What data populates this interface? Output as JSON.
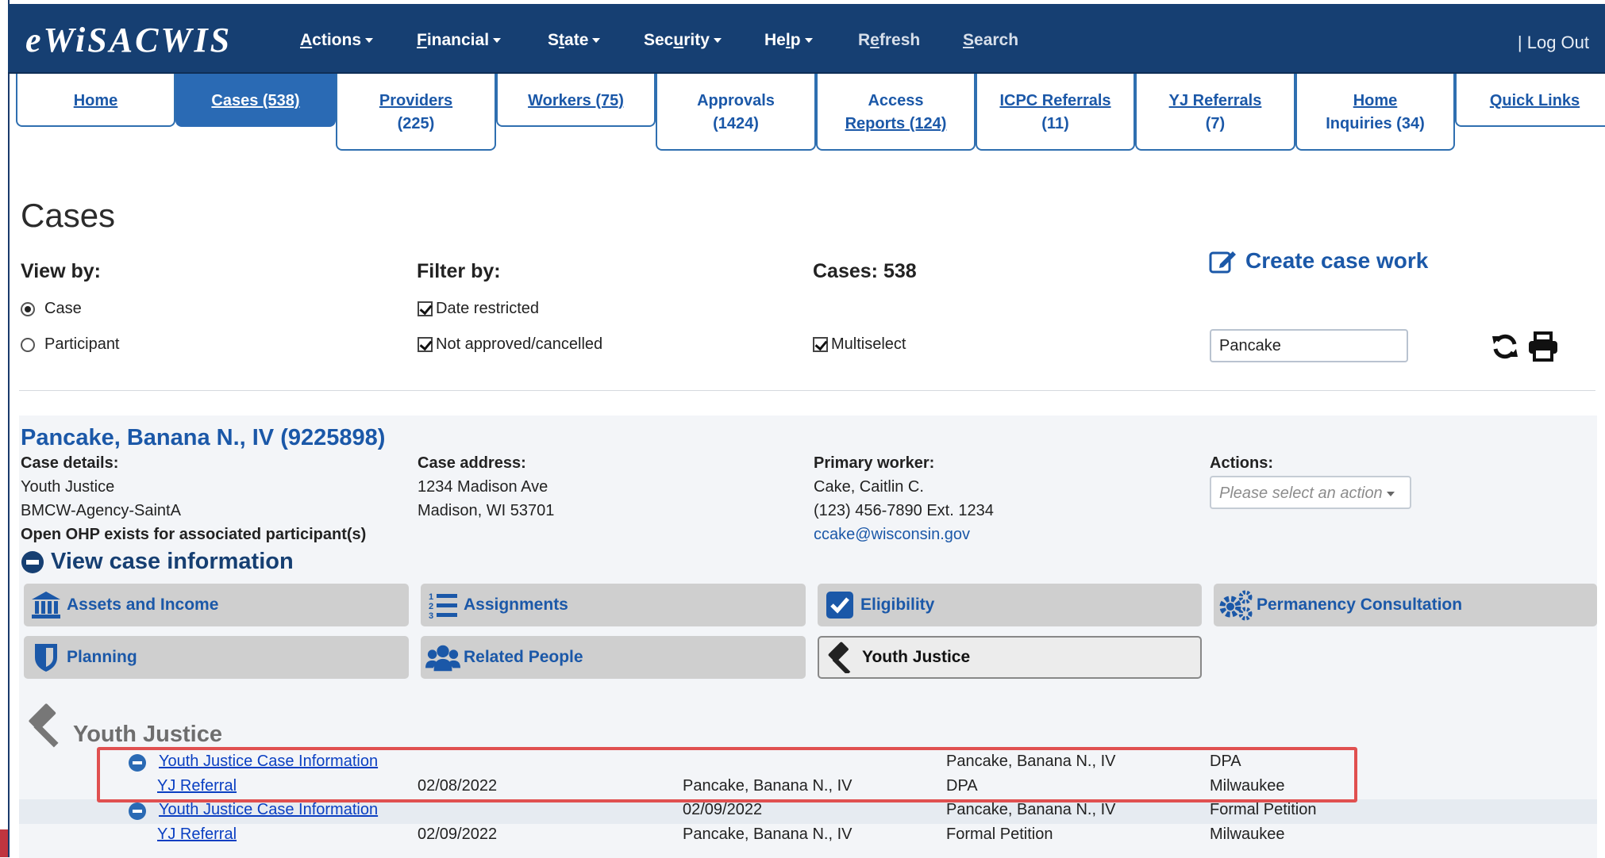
{
  "app": {
    "brand": "eWiSACWIS",
    "logout": "| Log Out"
  },
  "nav": {
    "items": [
      {
        "pre": "",
        "ul": "A",
        "post": "ctions"
      },
      {
        "pre": "",
        "ul": "F",
        "post": "inancial"
      },
      {
        "pre": "S",
        "ul": "t",
        "post": "ate"
      },
      {
        "pre": "Sec",
        "ul": "u",
        "post": "rity"
      },
      {
        "pre": "He",
        "ul": "l",
        "post": "p"
      },
      {
        "pre": "R",
        "ul": "e",
        "post": "fresh"
      },
      {
        "pre": "",
        "ul": "S",
        "post": "earch"
      }
    ]
  },
  "tabs": [
    {
      "line1": "Home",
      "line2": ""
    },
    {
      "line1": "Cases (538)",
      "line2": ""
    },
    {
      "line1": "Providers",
      "line2": "(225)"
    },
    {
      "line1": "Workers (75)",
      "line2": ""
    },
    {
      "line1": "Approvals",
      "line2": "(1424)"
    },
    {
      "line1": "Access",
      "line2": "Reports (124)"
    },
    {
      "line1": "ICPC Referrals",
      "line2": "(11)"
    },
    {
      "line1": "YJ Referrals",
      "line2": "(7)"
    },
    {
      "line1": "Home",
      "line2": "Inquiries (34)"
    },
    {
      "line1": "Quick Links",
      "line2": ""
    }
  ],
  "page": {
    "title": "Cases",
    "view_by_label": "View by:",
    "view_by_options": [
      "Case",
      "Participant"
    ],
    "view_by_selected": "Case",
    "filter_by_label": "Filter by:",
    "filter_options": [
      "Date restricted",
      "Not approved/cancelled"
    ],
    "cases_count": "Cases: 538",
    "multiselect_label": "Multiselect",
    "create_case_work": "Create case work",
    "search_value": "Pancake"
  },
  "case": {
    "title": "Pancake, Banana N., IV (9225898)",
    "details_label": "Case details:",
    "details": [
      "Youth Justice",
      "BMCW-Agency-SaintA",
      "Open OHP exists for associated participant(s)"
    ],
    "address_label": "Case address:",
    "address": [
      "1234 Madison Ave",
      "Madison, WI 53701"
    ],
    "worker_label": "Primary worker:",
    "worker": [
      "Cake, Caitlin C.",
      "(123) 456-7890 Ext. 1234"
    ],
    "worker_email": "ccake@wisconsin.gov",
    "actions_label": "Actions:",
    "actions_placeholder": "Please select an action",
    "view_case_info": "View case information"
  },
  "tiles": [
    {
      "label": "Assets and Income",
      "icon": "bank-icon"
    },
    {
      "label": "Assignments",
      "icon": "numbered-list-icon"
    },
    {
      "label": "Eligibility",
      "icon": "checkbox-icon"
    },
    {
      "label": "Permanency Consultation",
      "icon": "gears-icon"
    },
    {
      "label": "Planning",
      "icon": "shield-icon"
    },
    {
      "label": "Related People",
      "icon": "users-icon"
    },
    {
      "label": "Youth Justice",
      "icon": "gavel-icon"
    }
  ],
  "yj": {
    "heading": "Youth Justice",
    "rows": [
      {
        "c1": "Youth Justice Case Information",
        "c2": "",
        "c3": "",
        "c4": "Pancake, Banana N., IV",
        "c5": "DPA"
      },
      {
        "c1": "YJ Referral",
        "c2": "02/08/2022",
        "c3": "Pancake, Banana N., IV",
        "c4": "DPA",
        "c5": "Milwaukee"
      },
      {
        "c1": "Youth Justice Case Information",
        "c2": "",
        "c3": "02/09/2022",
        "c4": "Pancake, Banana N., IV",
        "c5": "Formal Petition"
      },
      {
        "c1": "YJ Referral",
        "c2": "02/09/2022",
        "c3": "Pancake, Banana N., IV",
        "c4": "Formal Petition",
        "c5": "Milwaukee"
      }
    ]
  },
  "colors": {
    "nav_bg": "#163f72",
    "accent": "#1b58a8",
    "active_tab": "#2a6ab4",
    "highlight": "#e05050"
  }
}
